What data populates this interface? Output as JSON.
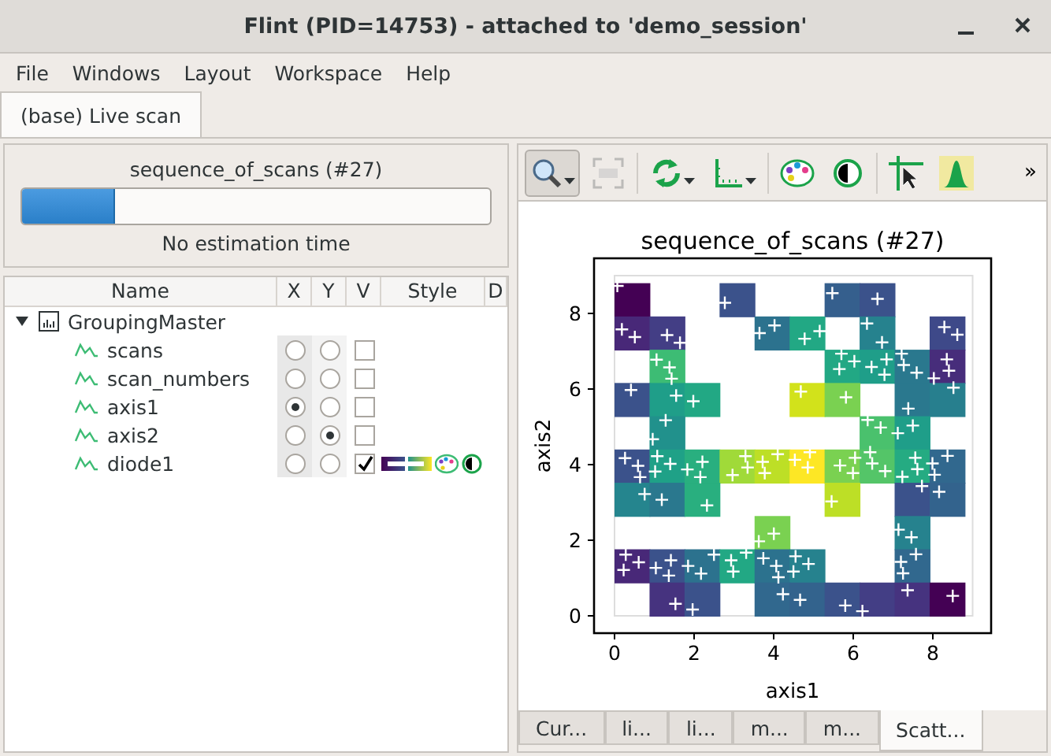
{
  "window": {
    "title": "Flint (PID=14753) - attached to 'demo_session'"
  },
  "menu": [
    "File",
    "Windows",
    "Layout",
    "Workspace",
    "Help"
  ],
  "tabs": [
    {
      "label": "(base) Live scan",
      "selected": true
    }
  ],
  "progress": {
    "label": "sequence_of_scans (#27)",
    "level": 0.2,
    "status": "No estimation time"
  },
  "tree": {
    "columns": [
      "Name",
      "X",
      "Y",
      "V",
      "Style",
      "D"
    ],
    "items": [
      {
        "label": "GroupingMaster",
        "expanded": true,
        "children": [
          {
            "label": "scans",
            "x_selected": false,
            "y_selected": false,
            "v_checked": false
          },
          {
            "label": "scan_numbers",
            "x_selected": false,
            "y_selected": false,
            "v_checked": false
          },
          {
            "label": "axis1",
            "x_selected": true,
            "y_selected": false,
            "v_checked": false
          },
          {
            "label": "axis2",
            "x_selected": false,
            "y_selected": true,
            "v_checked": false
          },
          {
            "label": "diode1",
            "x_selected": false,
            "y_selected": false,
            "v_checked": true
          }
        ]
      }
    ]
  },
  "toolbar": {
    "items": [
      {
        "kind": "zoom",
        "pressed": true,
        "dropdown": true
      },
      {
        "kind": "auto",
        "disabled": true
      },
      {
        "kind": "refresh",
        "dropdown": true
      },
      {
        "kind": "axes",
        "dropdown": true
      },
      {
        "kind": "palette"
      },
      {
        "kind": "contrast"
      },
      {
        "kind": "crosshair"
      },
      {
        "kind": "peak",
        "highlighted": true
      }
    ],
    "overflow": "»"
  },
  "plot": {
    "title": "sequence_of_scans (#27)",
    "xlabel": "axis1",
    "ylabel": "axis2",
    "xticks": [
      "0",
      "2",
      "4",
      "6",
      "8"
    ],
    "yticks": [
      "8",
      "6",
      "4",
      "2",
      "0"
    ]
  },
  "bottom_tabs": [
    {
      "label": "Cur...",
      "selected": false
    },
    {
      "label": "li...",
      "selected": false
    },
    {
      "label": "li...",
      "selected": false
    },
    {
      "label": "m...",
      "selected": false
    },
    {
      "label": "m...",
      "selected": false
    },
    {
      "label": "Scatt...",
      "selected": true
    }
  ]
}
